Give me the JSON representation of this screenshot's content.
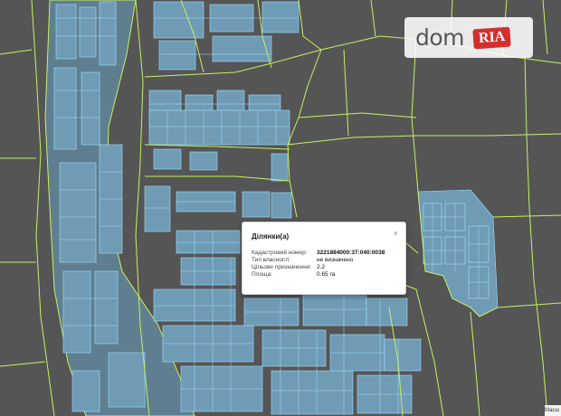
{
  "logo": {
    "brand_left": "dom",
    "brand_right": "RIA"
  },
  "popup": {
    "title": "Ділянки(а)",
    "close_symbol": "×",
    "rows": [
      {
        "label": "Кадастровий номер:",
        "value": "3221884000:37:040:0038"
      },
      {
        "label": "Тип власності:",
        "value": "не визначено"
      },
      {
        "label": "Цільове призначення:",
        "value": "2.2"
      },
      {
        "label": "Площа:",
        "value": "0.65 га"
      }
    ]
  },
  "scale": {
    "label": "Масш"
  },
  "colors": {
    "map_background": "#555555",
    "parcel_fill": "#6f9bb5",
    "parcel_stroke": "#9fe0ff",
    "boundary_lines": "#c8f060",
    "river": "#5f7f90"
  }
}
